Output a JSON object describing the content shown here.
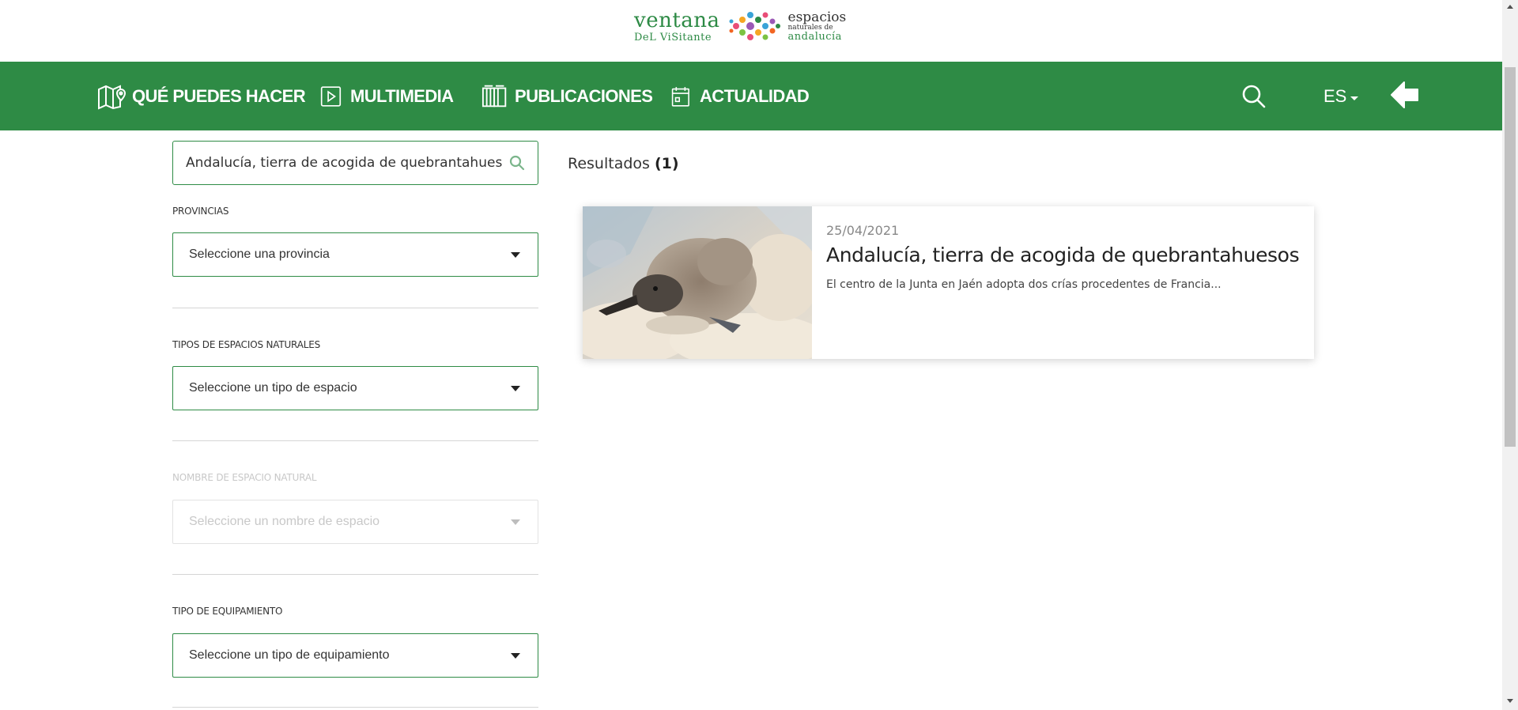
{
  "logo": {
    "ventana": "ventana",
    "del_visitante": "DeL ViSitante",
    "espacios": "espacios",
    "naturales_de": "naturales de",
    "andalucia": "andalucía"
  },
  "nav": {
    "items": [
      {
        "label": "QUÉ PUEDES HACER",
        "icon": "map-pin-icon"
      },
      {
        "label": "MULTIMEDIA",
        "icon": "play-icon"
      },
      {
        "label": "PUBLICACIONES",
        "icon": "book-icon"
      },
      {
        "label": "ACTUALIDAD",
        "icon": "calendar-icon"
      }
    ],
    "language": "ES",
    "search_icon": "search-icon",
    "back_icon": "back-arrow-icon"
  },
  "filters": {
    "search_value": "Andalucía, tierra de acogida de quebrantahuesos",
    "provincias": {
      "label": "PROVINCIAS",
      "placeholder": "Seleccione una provincia"
    },
    "tipos_espacios": {
      "label": "TIPOS DE ESPACIOS NATURALES",
      "placeholder": "Seleccione un tipo de espacio"
    },
    "nombre_espacio": {
      "label": "NOMBRE DE ESPACIO NATURAL",
      "placeholder": "Seleccione un nombre de espacio",
      "disabled": true
    },
    "tipo_equipamiento": {
      "label": "TIPO DE EQUIPAMIENTO",
      "placeholder": "Seleccione un tipo de equipamiento"
    }
  },
  "results": {
    "label": "Resultados",
    "count": "(1)",
    "items": [
      {
        "date": "25/04/2021",
        "title": "Andalucía, tierra de acogida de quebrantahuesos",
        "excerpt": "El centro de la Junta en Jaén adopta dos crías procedentes de Francia..."
      }
    ]
  },
  "colors": {
    "brand_green": "#2e8b45",
    "text_dark": "#222222",
    "text_muted": "#888888",
    "disabled": "#c8c8c8"
  }
}
